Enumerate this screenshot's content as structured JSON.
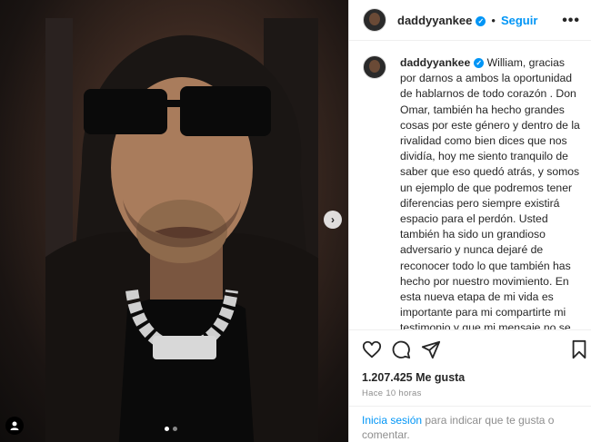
{
  "post": {
    "username": "daddyyankee",
    "verified_icon": "verified-badge-icon",
    "separator": "•",
    "follow_label": "Seguir",
    "more_label": "•••",
    "caption": "William, gracias por darnos a ambos la oportunidad de hablarnos de todo corazón . Don Omar, también ha hecho grandes cosas por este género y dentro de la rivalidad como bien dices que nos dividía, hoy me siento tranquilo de saber que eso quedó atrás, y somos un ejemplo de que podremos tener diferencias pero siempre existirá espacio para el perdón. Usted también ha sido un grandioso adversario y nunca dejaré de reconocer todo lo que también has hecho por nuestro movimiento. En esta nueva etapa de mi vida es importante para mi compartirte mi testimonio y que mi mensaje no se quede solo en palabras, si no en acciones, que son el mayor ejemplo",
    "likes": "1.207.425 Me gusta",
    "time": "Hace 10 horas",
    "login_link": "Inicia sesión",
    "login_rest": " para indicar que te gusta o comentar."
  },
  "carousel": {
    "next_icon": "›",
    "total_slides": 2,
    "active_slide": 1
  },
  "colors": {
    "accent": "#0095f6",
    "text": "#262626",
    "muted": "#8e8e8e"
  }
}
